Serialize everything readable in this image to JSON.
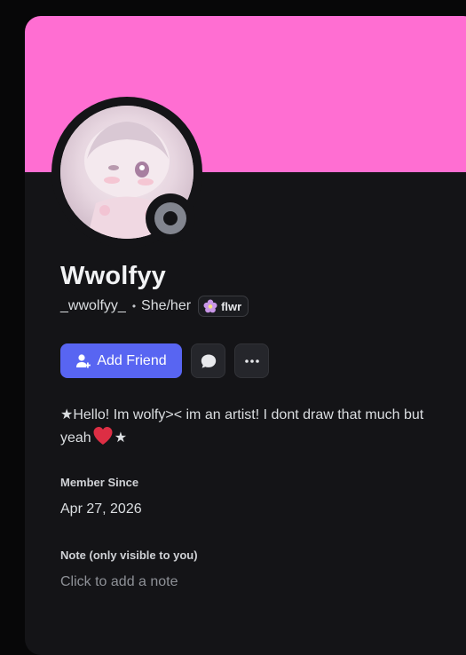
{
  "profile": {
    "display_name": "Wwolfyy",
    "username": "_wwolfyy_",
    "separator": "•",
    "pronouns": "She/her",
    "tag_badge": "flwr",
    "status": "offline",
    "banner_color": "#ff6ed2"
  },
  "actions": {
    "add_friend_label": "Add Friend",
    "message_icon": "chat-bubble-icon",
    "more_icon": "more-dots-icon",
    "accent_color": "#5865f2"
  },
  "bio": {
    "star_left": "★",
    "line_text": "Hello! Im wolfy>< im an artist! I dont draw that much but yeah",
    "heart": "♥",
    "star_right": "★"
  },
  "member_since": {
    "label": "Member Since",
    "value": "Apr 27, 2026"
  },
  "note": {
    "label": "Note (only visible to you)",
    "placeholder": "Click to add a note"
  }
}
